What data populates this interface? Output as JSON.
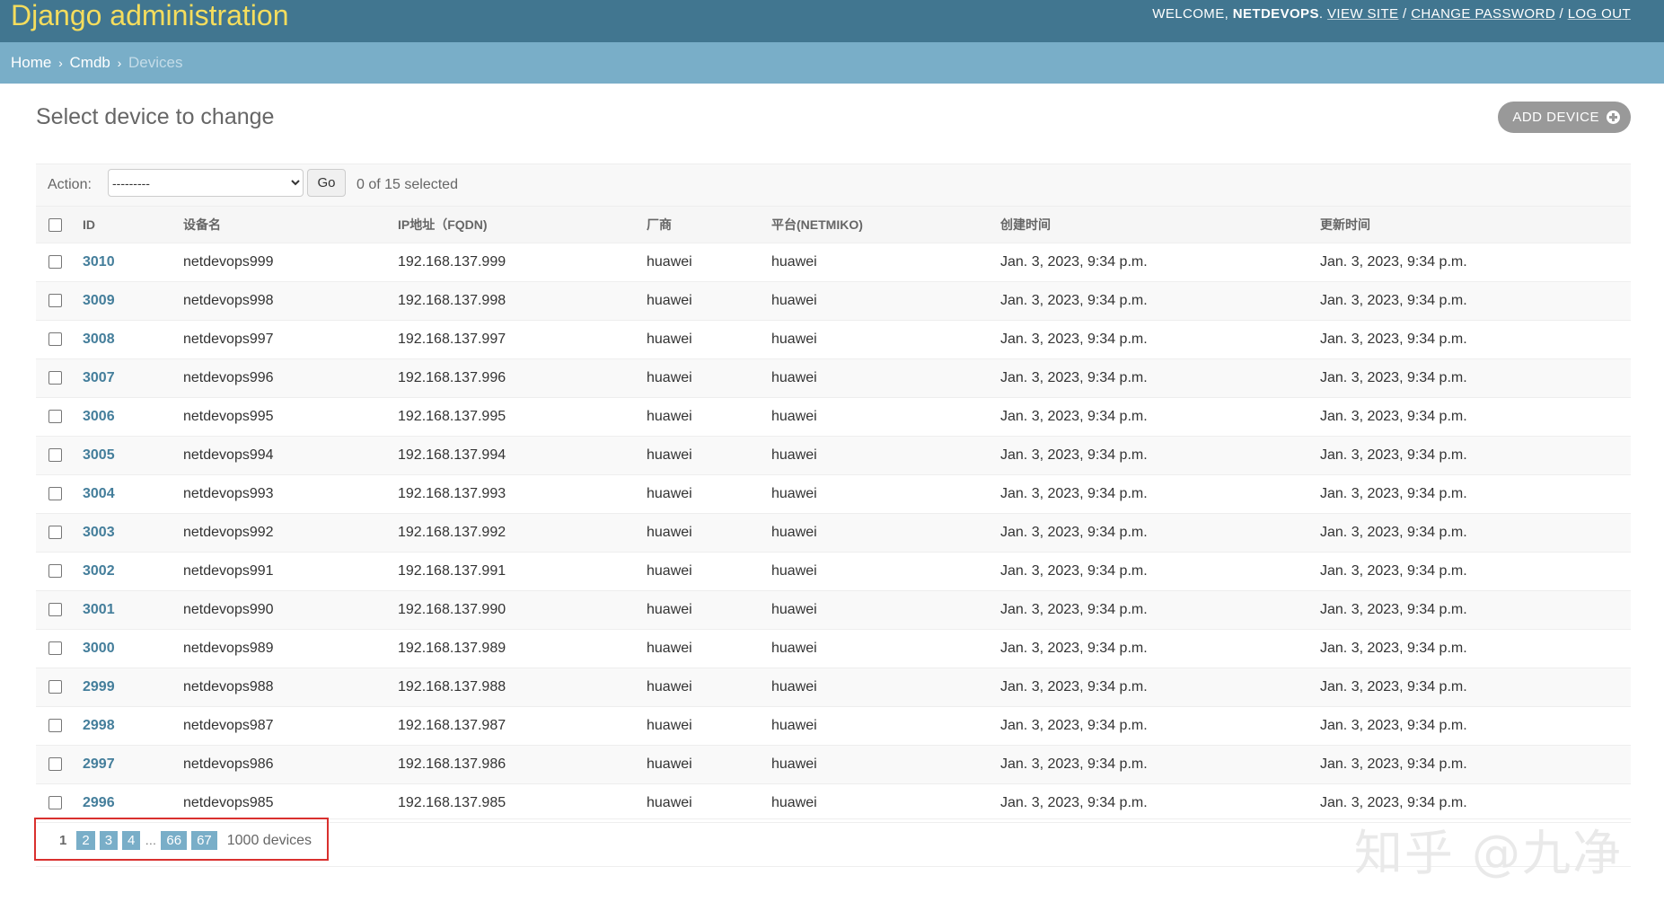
{
  "header": {
    "brand": "Django administration",
    "welcome": "Welcome,",
    "username": "netdevops",
    "links": [
      "View site",
      "Change password",
      "Log out"
    ]
  },
  "breadcrumbs": {
    "home": "Home",
    "app": "Cmdb",
    "current": "Devices",
    "separator": "›"
  },
  "page_title": "Select device to change",
  "add_button": "ADD DEVICE",
  "actions": {
    "label": "Action:",
    "select_value": "---------",
    "go": "Go",
    "counter": "0 of 15 selected"
  },
  "table": {
    "headers": [
      "ID",
      "设备名",
      "IP地址（FQDN)",
      "厂商",
      "平台(NETMIKO)",
      "创建时间",
      "更新时间"
    ],
    "rows": [
      [
        "3010",
        "netdevops999",
        "192.168.137.999",
        "huawei",
        "huawei",
        "Jan. 3, 2023, 9:34 p.m.",
        "Jan. 3, 2023, 9:34 p.m."
      ],
      [
        "3009",
        "netdevops998",
        "192.168.137.998",
        "huawei",
        "huawei",
        "Jan. 3, 2023, 9:34 p.m.",
        "Jan. 3, 2023, 9:34 p.m."
      ],
      [
        "3008",
        "netdevops997",
        "192.168.137.997",
        "huawei",
        "huawei",
        "Jan. 3, 2023, 9:34 p.m.",
        "Jan. 3, 2023, 9:34 p.m."
      ],
      [
        "3007",
        "netdevops996",
        "192.168.137.996",
        "huawei",
        "huawei",
        "Jan. 3, 2023, 9:34 p.m.",
        "Jan. 3, 2023, 9:34 p.m."
      ],
      [
        "3006",
        "netdevops995",
        "192.168.137.995",
        "huawei",
        "huawei",
        "Jan. 3, 2023, 9:34 p.m.",
        "Jan. 3, 2023, 9:34 p.m."
      ],
      [
        "3005",
        "netdevops994",
        "192.168.137.994",
        "huawei",
        "huawei",
        "Jan. 3, 2023, 9:34 p.m.",
        "Jan. 3, 2023, 9:34 p.m."
      ],
      [
        "3004",
        "netdevops993",
        "192.168.137.993",
        "huawei",
        "huawei",
        "Jan. 3, 2023, 9:34 p.m.",
        "Jan. 3, 2023, 9:34 p.m."
      ],
      [
        "3003",
        "netdevops992",
        "192.168.137.992",
        "huawei",
        "huawei",
        "Jan. 3, 2023, 9:34 p.m.",
        "Jan. 3, 2023, 9:34 p.m."
      ],
      [
        "3002",
        "netdevops991",
        "192.168.137.991",
        "huawei",
        "huawei",
        "Jan. 3, 2023, 9:34 p.m.",
        "Jan. 3, 2023, 9:34 p.m."
      ],
      [
        "3001",
        "netdevops990",
        "192.168.137.990",
        "huawei",
        "huawei",
        "Jan. 3, 2023, 9:34 p.m.",
        "Jan. 3, 2023, 9:34 p.m."
      ],
      [
        "3000",
        "netdevops989",
        "192.168.137.989",
        "huawei",
        "huawei",
        "Jan. 3, 2023, 9:34 p.m.",
        "Jan. 3, 2023, 9:34 p.m."
      ],
      [
        "2999",
        "netdevops988",
        "192.168.137.988",
        "huawei",
        "huawei",
        "Jan. 3, 2023, 9:34 p.m.",
        "Jan. 3, 2023, 9:34 p.m."
      ],
      [
        "2998",
        "netdevops987",
        "192.168.137.987",
        "huawei",
        "huawei",
        "Jan. 3, 2023, 9:34 p.m.",
        "Jan. 3, 2023, 9:34 p.m."
      ],
      [
        "2997",
        "netdevops986",
        "192.168.137.986",
        "huawei",
        "huawei",
        "Jan. 3, 2023, 9:34 p.m.",
        "Jan. 3, 2023, 9:34 p.m."
      ],
      [
        "2996",
        "netdevops985",
        "192.168.137.985",
        "huawei",
        "huawei",
        "Jan. 3, 2023, 9:34 p.m.",
        "Jan. 3, 2023, 9:34 p.m."
      ]
    ]
  },
  "paginator": {
    "current": "1",
    "pages": [
      "2",
      "3",
      "4"
    ],
    "ellipsis": "…",
    "last_pages": [
      "66",
      "67"
    ],
    "count": "1000 devices"
  },
  "watermark": "知乎 @九净",
  "colors": {
    "header_bg": "#417690",
    "brand": "#f5dd5d",
    "breadcrumb_bg": "#79aec8",
    "link": "#447e9b",
    "highlight_box": "#d9302e"
  }
}
